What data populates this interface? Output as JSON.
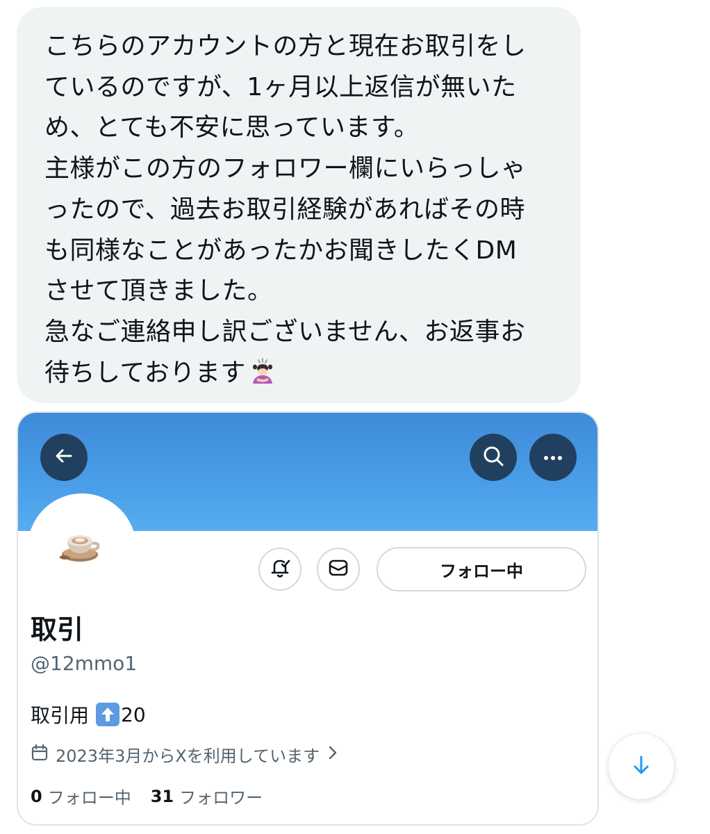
{
  "message": {
    "lines": [
      "こちらのアカウントの方と現在お取引をし",
      "ているのですが、1ヶ月以上返信が無いた",
      "め、とても不安に思っています。",
      "主様がこの方のフォロワー欄にいらっしゃ",
      "ったので、過去お取引経験があればその時",
      "も同様なことがあったかお聞きしたくDM",
      "させて頂きました。",
      "急なご連絡申し訳ございません、お返事お",
      "待ちしております"
    ],
    "emoji": "bowing-person-emoji"
  },
  "profile_card": {
    "banner_color": "#4a9ee8",
    "header_buttons": [
      "back-arrow-icon",
      "search-icon",
      "more-icon"
    ],
    "avatar_icon": "latte-cup-icon",
    "following_label": "フォロー中",
    "display_name": "取引",
    "handle": "@12mmo1",
    "bio": {
      "text": "取引用",
      "emoji": "up-arrow-emoji",
      "number": "20"
    },
    "joined": "2023年3月からXを利用しています",
    "stats": {
      "following_count": "0",
      "following_label": "フォロー中",
      "followers_count": "31",
      "followers_label": "フォロワー"
    }
  },
  "scroll_down_icon": "arrow-down-icon",
  "colors": {
    "bubble_bg": "#eff3f4",
    "header_button_bg": "#21405f",
    "accent_blue": "#1d9bf0",
    "secondary_text": "#536471"
  }
}
